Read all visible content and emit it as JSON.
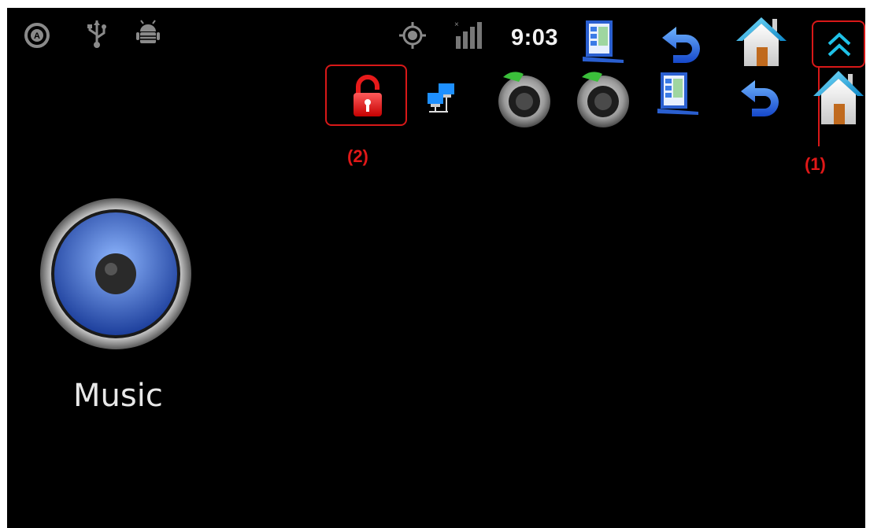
{
  "status_bar": {
    "time": "9:03",
    "left_icons": [
      "autorotate-icon",
      "usb-icon",
      "android-debug-icon"
    ],
    "right_icons": [
      "gps-icon",
      "signal-icon"
    ]
  },
  "toolbar_row1": [
    "tasklist-icon",
    "back-icon",
    "home-icon",
    "expand-up-icon"
  ],
  "toolbar_row2": [
    "lock-icon",
    "network-icon",
    "volume-down-icon",
    "volume-up-icon",
    "tasklist-icon",
    "back-icon",
    "home-icon"
  ],
  "annotations": {
    "label_1": "(1)",
    "label_2": "(2)",
    "color": "#d81818"
  },
  "desktop": {
    "app_label": "Music",
    "app_icon": "speaker-icon"
  }
}
